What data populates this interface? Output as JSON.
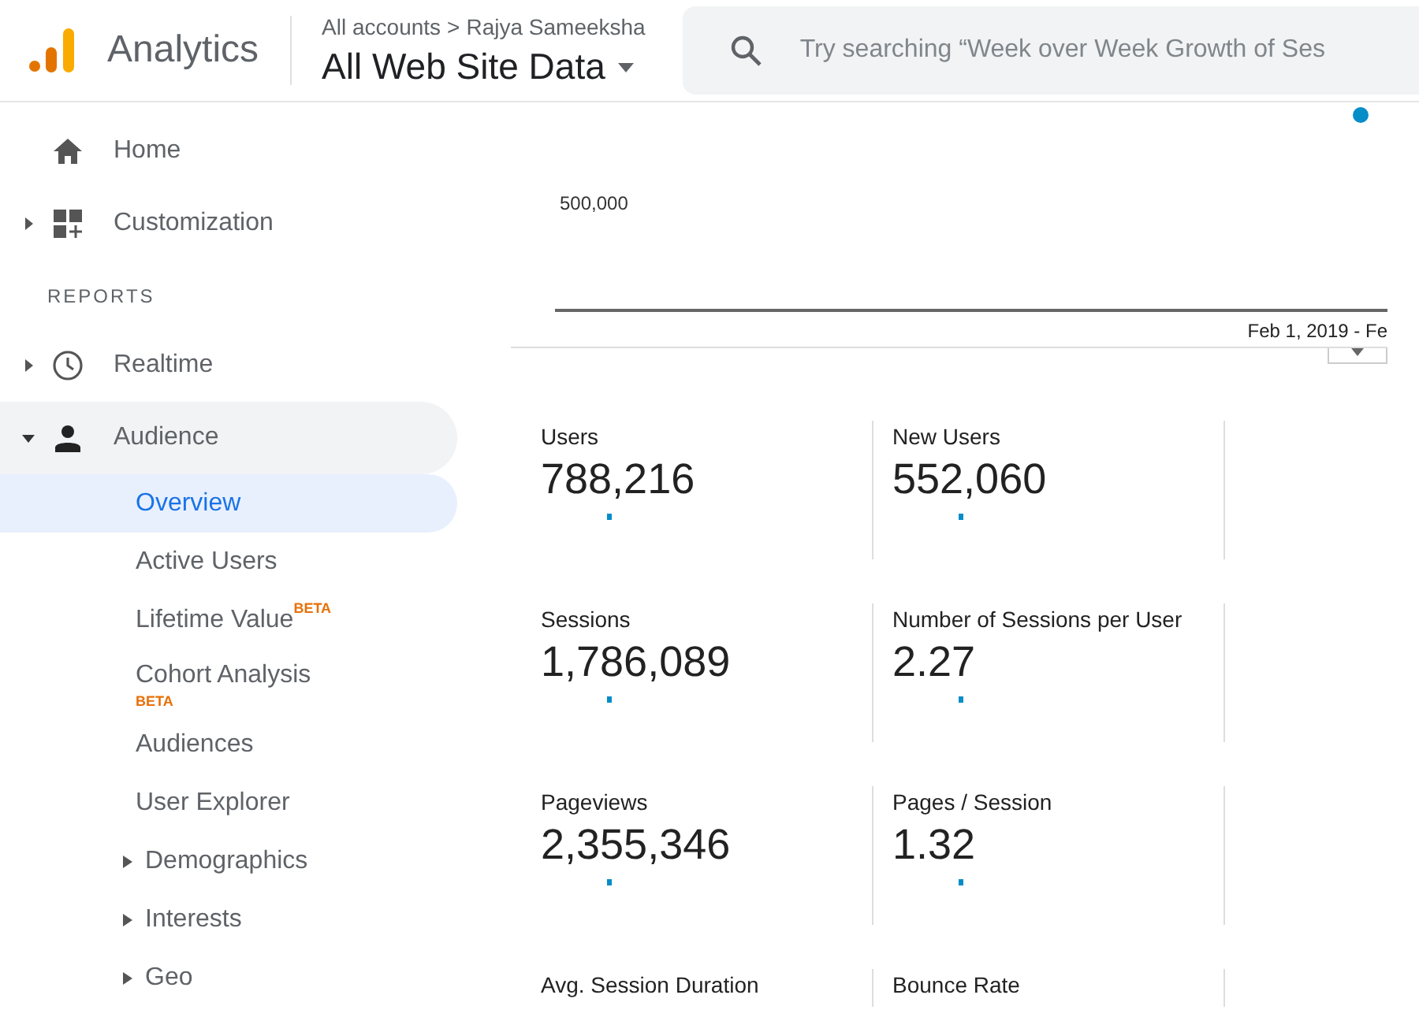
{
  "header": {
    "product": "Analytics",
    "breadcrumb": [
      "All accounts",
      "Rajya Sameeksha"
    ],
    "breadcrumb_separator": ">",
    "view": "All Web Site Data",
    "search": {
      "placeholder": "Try searching “Week over Week Growth of Ses"
    }
  },
  "sidebar": {
    "items": [
      {
        "kind": "nav",
        "label": "Home",
        "has_caret": false,
        "selected": false
      },
      {
        "kind": "nav",
        "label": "Customization",
        "has_caret": true,
        "expanded": false,
        "selected": false
      },
      {
        "kind": "section",
        "label": "REPORTS"
      },
      {
        "kind": "nav",
        "label": "Realtime",
        "has_caret": true,
        "expanded": false,
        "selected": false
      },
      {
        "kind": "nav",
        "label": "Audience",
        "has_caret": true,
        "expanded": true,
        "selected": true,
        "children": [
          {
            "label": "Overview",
            "selected": true,
            "has_caret": false
          },
          {
            "label": "Active Users",
            "selected": false,
            "has_caret": false
          },
          {
            "label": "Lifetime Value",
            "badge": "BETA",
            "kind": "inline",
            "selected": false,
            "has_caret": false
          },
          {
            "label": "Cohort Analysis",
            "badge": "BETA",
            "kind": "stacked",
            "selected": false,
            "has_caret": false
          },
          {
            "label": "Audiences",
            "selected": false,
            "has_caret": false
          },
          {
            "label": "User Explorer",
            "selected": false,
            "has_caret": false
          },
          {
            "label": "Demographics",
            "selected": false,
            "has_caret": true
          },
          {
            "label": "Interests",
            "selected": false,
            "has_caret": true
          },
          {
            "label": "Geo",
            "selected": false,
            "has_caret": true
          }
        ]
      }
    ]
  },
  "chart": {
    "y_tick": "500,000",
    "date_range": "Feb 1, 2019 - Fe"
  },
  "metrics": [
    {
      "label": "Users",
      "value": "788,216"
    },
    {
      "label": "New Users",
      "value": "552,060"
    },
    {
      "label": "Sessions",
      "value": "1,786,089"
    },
    {
      "label": "Number of Sessions per User",
      "value": "2.27"
    },
    {
      "label": "Pageviews",
      "value": "2,355,346"
    },
    {
      "label": "Pages / Session",
      "value": "1.32"
    },
    {
      "label": "Avg. Session Duration"
    },
    {
      "label": "Bounce Rate"
    }
  ]
}
